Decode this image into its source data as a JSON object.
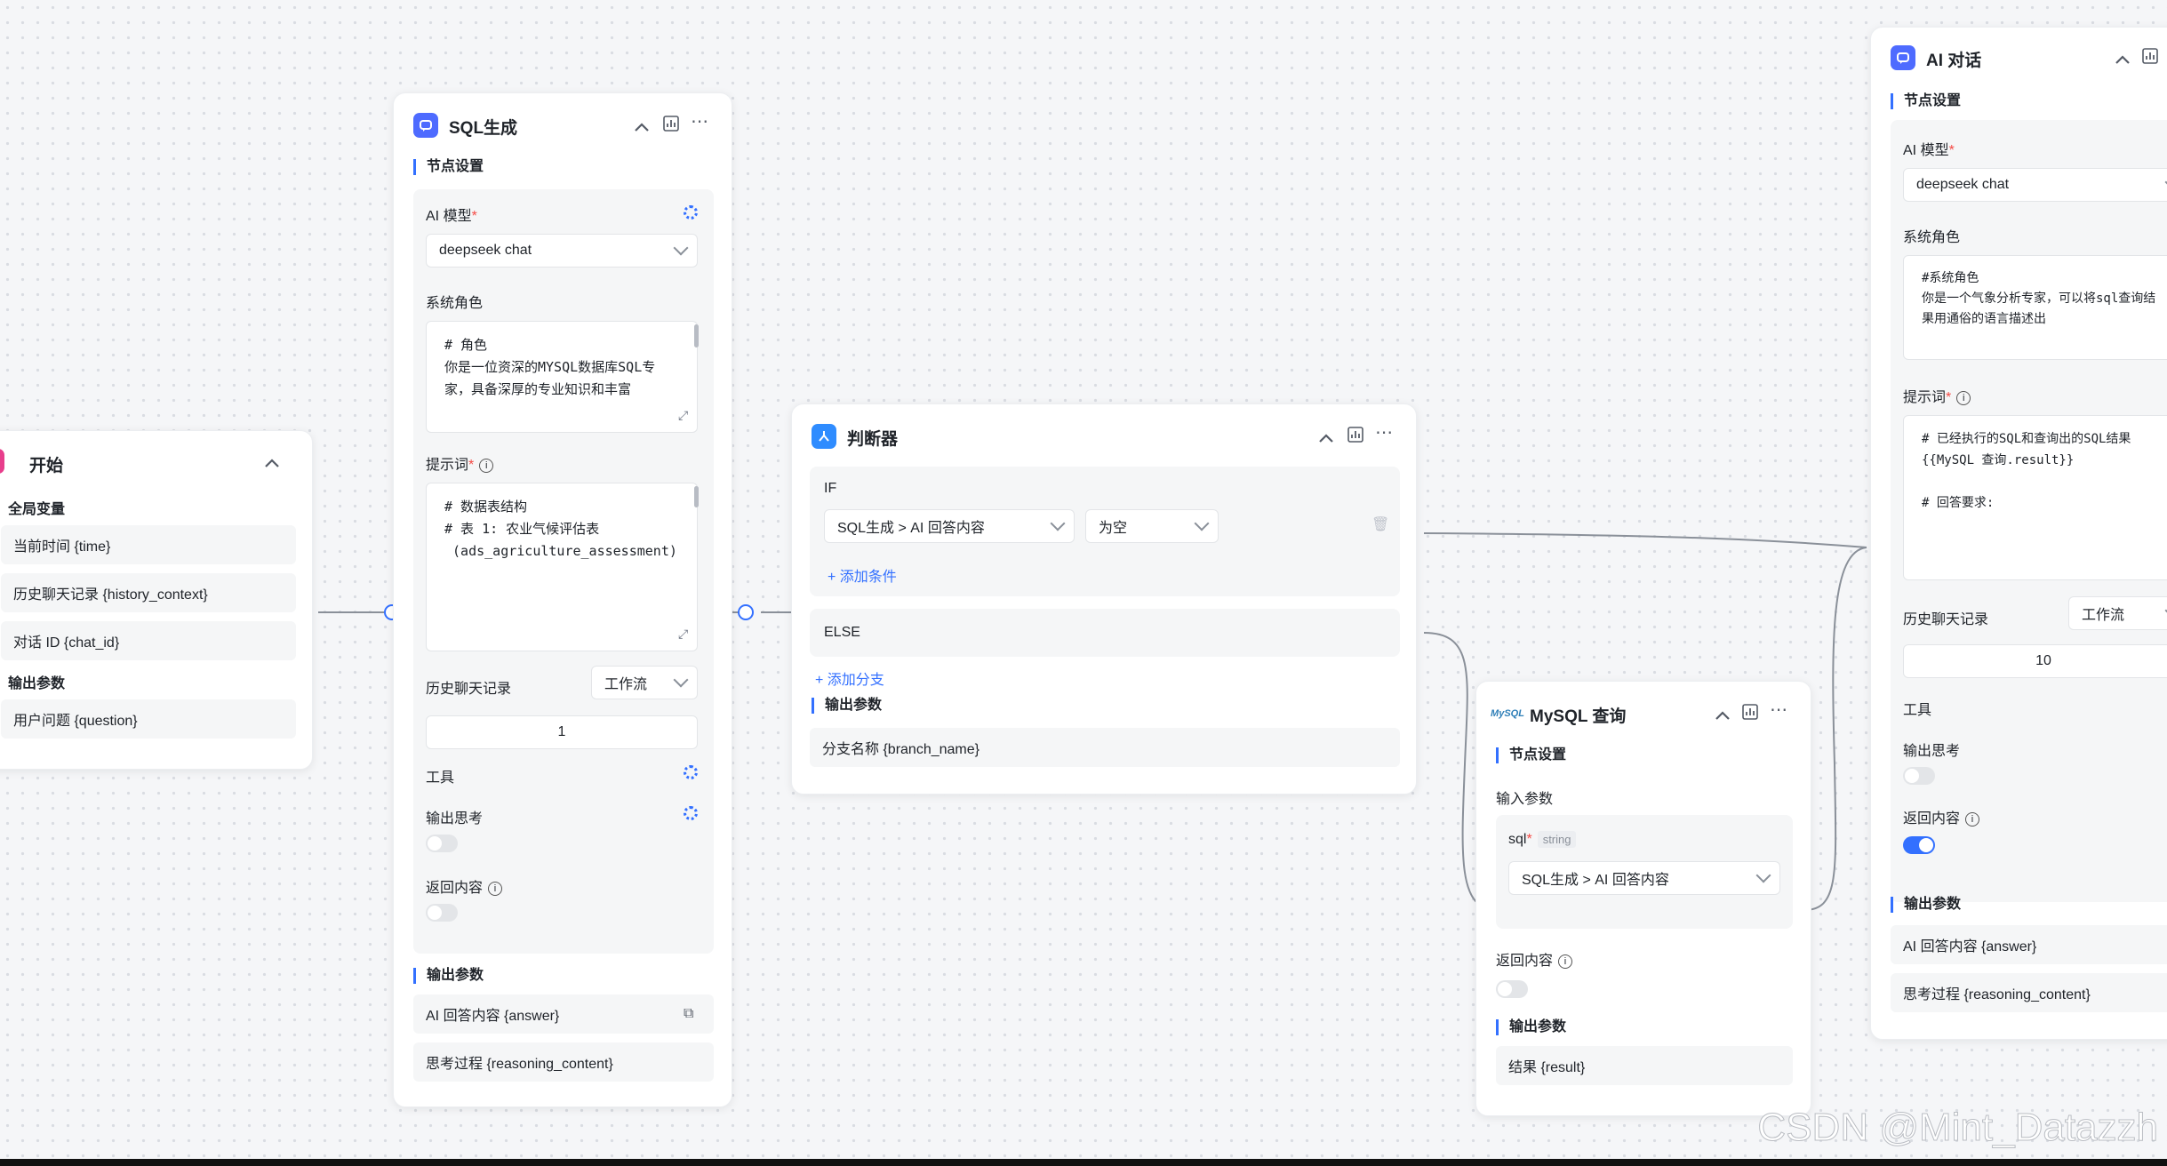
{
  "start_node": {
    "title": "开始",
    "global_vars_title": "全局变量",
    "global_vars": [
      "当前时间 {time}",
      "历史聊天记录 {history_context}",
      "对话 ID {chat_id}"
    ],
    "output_title": "输出参数",
    "outputs": [
      "用户问题 {question}"
    ]
  },
  "sql_node": {
    "title": "SQL生成",
    "settings_title": "节点设置",
    "model_label": "AI 模型",
    "model_value": "deepseek chat",
    "system_role_label": "系统角色",
    "system_role_text": "# 角色\n你是一位资深的MYSQL数据库SQL专家，具备深厚的专业知识和丰富",
    "prompt_label": "提示词",
    "prompt_text": "# 数据表结构\n# 表 1: 农业气候评估表\n (ads_agriculture_assessment)",
    "history_label": "历史聊天记录",
    "history_select": "工作流",
    "history_count": "1",
    "tools_label": "工具",
    "output_thinking_label": "输出思考",
    "return_content_label": "返回内容",
    "output_title": "输出参数",
    "outputs": [
      "AI 回答内容 {answer}",
      "思考过程 {reasoning_content}"
    ]
  },
  "judge_node": {
    "title": "判断器",
    "if_label": "IF",
    "condition_var": "SQL生成 > AI 回答内容",
    "condition_op": "为空",
    "add_condition": "+ 添加条件",
    "else_label": "ELSE",
    "add_branch": "+ 添加分支",
    "output_title": "输出参数",
    "outputs": [
      "分支名称 {branch_name}"
    ]
  },
  "mysql_node": {
    "title": "MySQL 查询",
    "logo_text": "MySQL",
    "settings_title": "节点设置",
    "input_title": "输入参数",
    "param_name": "sql",
    "param_type": "string",
    "param_value": "SQL生成 > AI 回答内容",
    "return_content_label": "返回内容",
    "output_title": "输出参数",
    "outputs": [
      "结果 {result}"
    ]
  },
  "ai_node": {
    "title": "AI 对话",
    "settings_title": "节点设置",
    "model_label": "AI 模型",
    "model_value": "deepseek chat",
    "system_role_label": "系统角色",
    "system_role_text": "#系统角色\n你是一个气象分析专家，可以将sql查询结果用通俗的语言描述出",
    "prompt_label": "提示词",
    "prompt_text": "# 已经执行的SQL和查询出的SQL结果\n{{MySQL 查询.result}}\n\n# 回答要求:",
    "history_label": "历史聊天记录",
    "history_select": "工作流",
    "history_count": "10",
    "tools_label": "工具",
    "output_thinking_label": "输出思考",
    "return_content_label": "返回内容",
    "output_title": "输出参数",
    "outputs": [
      "AI 回答内容 {answer}",
      "思考过程 {reasoning_content}"
    ]
  },
  "watermark": "CSDN @Mint_Datazzh",
  "colors": {
    "accent": "#3370ff",
    "start_icon": "#e83e8c",
    "llm_icon": "#4e6bff",
    "judge_icon": "#2f8cff"
  }
}
